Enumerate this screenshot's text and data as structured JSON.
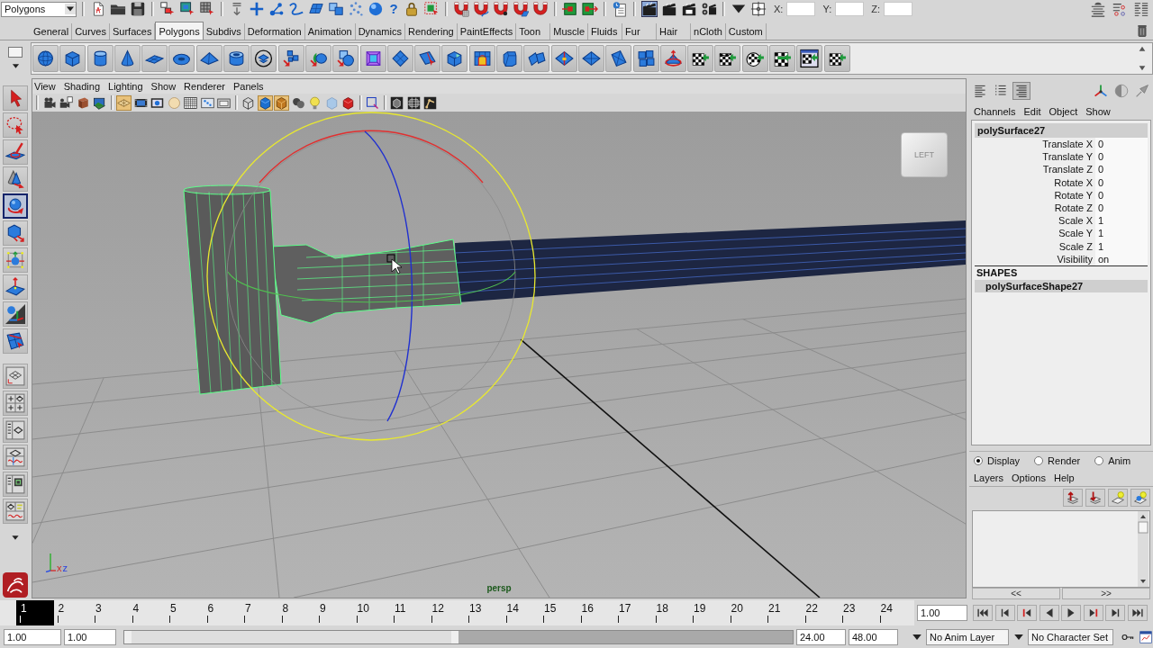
{
  "status_line": {
    "menu_set": "Polygons",
    "help": "?",
    "fields": [
      {
        "label": "X:"
      },
      {
        "label": "Y:"
      },
      {
        "label": "Z:"
      }
    ]
  },
  "shelf": {
    "tabs": [
      {
        "label": "General",
        "selected": false
      },
      {
        "label": "Curves",
        "selected": false
      },
      {
        "label": "Surfaces",
        "selected": false
      },
      {
        "label": "Polygons",
        "selected": true
      },
      {
        "label": "Subdivs",
        "selected": false
      },
      {
        "label": "Deformation",
        "selected": false
      },
      {
        "label": "Animation",
        "selected": false
      },
      {
        "label": "Dynamics",
        "selected": false
      },
      {
        "label": "Rendering",
        "selected": false
      },
      {
        "label": "PaintEffects",
        "selected": false
      },
      {
        "label": "Toon",
        "selected": false
      },
      {
        "label": "Muscle",
        "selected": false
      },
      {
        "label": "Fluids",
        "selected": false
      },
      {
        "label": "Fur",
        "selected": false
      },
      {
        "label": "Hair",
        "selected": false
      },
      {
        "label": "nCloth",
        "selected": false
      },
      {
        "label": "Custom",
        "selected": false
      }
    ]
  },
  "toolbox": {
    "tools": [
      {
        "selected": false
      },
      {
        "selected": false
      },
      {
        "selected": false
      },
      {
        "selected": false
      },
      {
        "selected": true
      },
      {
        "selected": false
      },
      {
        "selected": false
      },
      {
        "selected": false
      },
      {
        "selected": false
      },
      {
        "selected": false
      }
    ]
  },
  "viewport": {
    "menus": [
      "View",
      "Shading",
      "Lighting",
      "Show",
      "Renderer",
      "Panels"
    ],
    "toolbar": [
      {
        "on": false
      },
      {
        "on": false
      },
      {
        "on": false
      },
      {
        "on": false
      },
      {
        "on": true
      },
      {
        "on": false
      },
      {
        "on": false
      },
      {
        "on": false
      },
      {
        "on": false
      },
      {
        "on": false
      },
      {
        "on": false
      },
      {
        "on": false
      },
      {
        "on": true
      },
      {
        "on": true
      },
      {
        "on": false
      },
      {
        "on": false
      },
      {
        "on": false
      },
      {
        "on": false
      },
      {
        "on": false
      },
      {
        "on": false
      },
      {
        "on": false
      },
      {
        "on": false
      }
    ],
    "view_cube": "LEFT",
    "axis_labels": [
      "x",
      "z"
    ],
    "camera": "persp"
  },
  "channel_box": {
    "layout_buttons": [
      {
        "selected": false
      },
      {
        "selected": false
      },
      {
        "selected": true
      }
    ],
    "menus": [
      "Channels",
      "Edit",
      "Object",
      "Show"
    ],
    "object": "polySurface27",
    "channels": [
      {
        "name": "Translate X",
        "value": "0"
      },
      {
        "name": "Translate Y",
        "value": "0"
      },
      {
        "name": "Translate Z",
        "value": "0"
      },
      {
        "name": "Rotate X",
        "value": "0"
      },
      {
        "name": "Rotate Y",
        "value": "0"
      },
      {
        "name": "Rotate Z",
        "value": "0"
      },
      {
        "name": "Scale X",
        "value": "1"
      },
      {
        "name": "Scale Y",
        "value": "1"
      },
      {
        "name": "Scale Z",
        "value": "1"
      },
      {
        "name": "Visibility",
        "value": "on"
      }
    ],
    "shapes_heading": "SHAPES",
    "shapes": [
      "polySurfaceShape27"
    ]
  },
  "layer_editor": {
    "modes": [
      {
        "label": "Display",
        "selected": true
      },
      {
        "label": "Render",
        "selected": false
      },
      {
        "label": "Anim",
        "selected": false
      }
    ],
    "menus": [
      "Layers",
      "Options",
      "Help"
    ],
    "nav": [
      "<<",
      ">>"
    ]
  },
  "time_slider": {
    "frames": [
      {
        "label": "1",
        "selected": true
      },
      {
        "label": "2",
        "selected": false
      },
      {
        "label": "3",
        "selected": false
      },
      {
        "label": "4",
        "selected": false
      },
      {
        "label": "5",
        "selected": false
      },
      {
        "label": "6",
        "selected": false
      },
      {
        "label": "7",
        "selected": false
      },
      {
        "label": "8",
        "selected": false
      },
      {
        "label": "9",
        "selected": false
      },
      {
        "label": "10",
        "selected": false
      },
      {
        "label": "11",
        "selected": false
      },
      {
        "label": "12",
        "selected": false
      },
      {
        "label": "13",
        "selected": false
      },
      {
        "label": "14",
        "selected": false
      },
      {
        "label": "15",
        "selected": false
      },
      {
        "label": "16",
        "selected": false
      },
      {
        "label": "17",
        "selected": false
      },
      {
        "label": "18",
        "selected": false
      },
      {
        "label": "19",
        "selected": false
      },
      {
        "label": "20",
        "selected": false
      },
      {
        "label": "21",
        "selected": false
      },
      {
        "label": "22",
        "selected": false
      },
      {
        "label": "23",
        "selected": false
      },
      {
        "label": "24",
        "selected": false
      }
    ],
    "current_time": "1.00"
  },
  "range_slider": {
    "start": "1.00",
    "playback_start": "1.00",
    "level": 0.5,
    "playback_end": "24.00",
    "end": "48.00"
  },
  "anim_layer": "No Anim Layer",
  "character_set": "No Character Set"
}
